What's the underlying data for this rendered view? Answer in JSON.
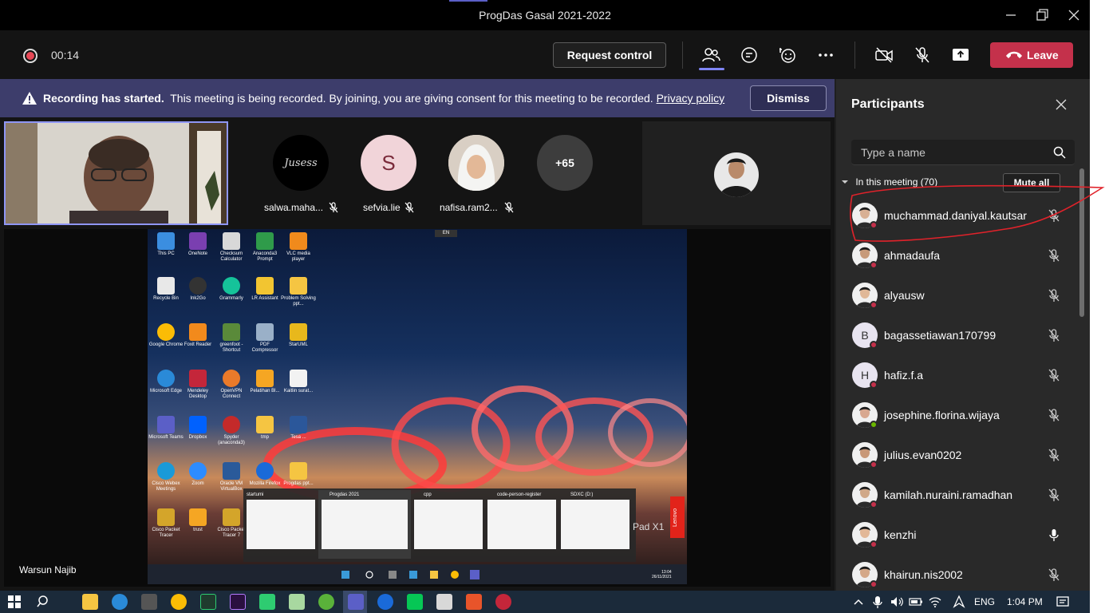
{
  "window": {
    "title": "ProgDas Gasal 2021-2022"
  },
  "toolbar": {
    "timer": "00:14",
    "request_control_label": "Request control",
    "leave_label": "Leave"
  },
  "banner": {
    "title": "Recording has started.",
    "message": "This meeting is being recorded. By joining, you are giving consent for this meeting to be recorded.",
    "privacy_link": "Privacy policy",
    "dismiss_label": "Dismiss"
  },
  "stage": {
    "avatars": [
      {
        "name": "salwa.maha...",
        "initial": "",
        "color": "#000000"
      },
      {
        "name": "sefvia.lie",
        "initial": "S",
        "color": "#f1d4d9"
      },
      {
        "name": "nafisa.ram2...",
        "initial": "",
        "color": "#d9cfc4"
      },
      {
        "name": "",
        "initial": "+65",
        "color": "#3d3d3d"
      }
    ],
    "presenter_name": "Warsun Najib"
  },
  "shared_screen": {
    "desktop_icons": [
      "This PC",
      "OneNote",
      "Checksum Calculator",
      "Anaconda3 Prompt",
      "VLC media player",
      "Recycle Bin",
      "Ink2Go",
      "Grammarly",
      "LR Assistant",
      "Problem Solving ppt...",
      "Google Chrome",
      "Foxit Reader",
      "greenfoot - Shortcut",
      "PDF Compressor",
      "StarUML",
      "Microsoft Edge",
      "Mendeley Desktop",
      "OpenVPN Connect",
      "Pelatihan Bl...",
      "Kaitlin surat...",
      "Microsoft Teams",
      "Dropbox",
      "Spyder (anaconda3)",
      "tmp",
      "Tesa ...",
      "Cisco Webex Meetings",
      "Zoom",
      "Oracle VM VirtualBox",
      "Mozilla Firefox",
      "Progdas ppt...",
      "Cisco Packet Tracer",
      "trust",
      "Cisco Packet Tracer 7"
    ],
    "explorer_windows": [
      "startumi",
      "Progdas 2021",
      "cpp",
      "code-person-register",
      "SDXC (D:)"
    ],
    "lang": "EN",
    "time": "13:04",
    "date": "26/11/2021",
    "brand": "Lenovo",
    "brand_text": "Pad X1"
  },
  "participants": {
    "title": "Participants",
    "search_placeholder": "Type a name",
    "section_label": "In this meeting (70)",
    "mute_all_label": "Mute all",
    "list": [
      {
        "name": "muchammad.daniyal.kautsar",
        "initial": "",
        "status": "red",
        "mic": "muted"
      },
      {
        "name": "ahmadaufa",
        "initial": "",
        "status": "red",
        "mic": "muted"
      },
      {
        "name": "alyausw",
        "initial": "",
        "status": "red",
        "mic": "muted"
      },
      {
        "name": "bagassetiawan170799",
        "initial": "B",
        "status": "red",
        "mic": "muted"
      },
      {
        "name": "hafiz.f.a",
        "initial": "H",
        "status": "red",
        "mic": "muted"
      },
      {
        "name": "josephine.florina.wijaya",
        "initial": "",
        "status": "green",
        "mic": "muted"
      },
      {
        "name": "julius.evan0202",
        "initial": "",
        "status": "red",
        "mic": "muted"
      },
      {
        "name": "kamilah.nuraini.ramadhan",
        "initial": "",
        "status": "red",
        "mic": "muted"
      },
      {
        "name": "kenzhi",
        "initial": "",
        "status": "red",
        "mic": "on"
      },
      {
        "name": "khairun.nis2002",
        "initial": "",
        "status": "red",
        "mic": "muted"
      }
    ]
  },
  "taskbar": {
    "language": "ENG",
    "time": "1:04 PM"
  },
  "colors": {
    "accent": "#7f85f5",
    "leave": "#c4314b",
    "banner": "#3d3d6b",
    "annotation": "#e0222a"
  }
}
